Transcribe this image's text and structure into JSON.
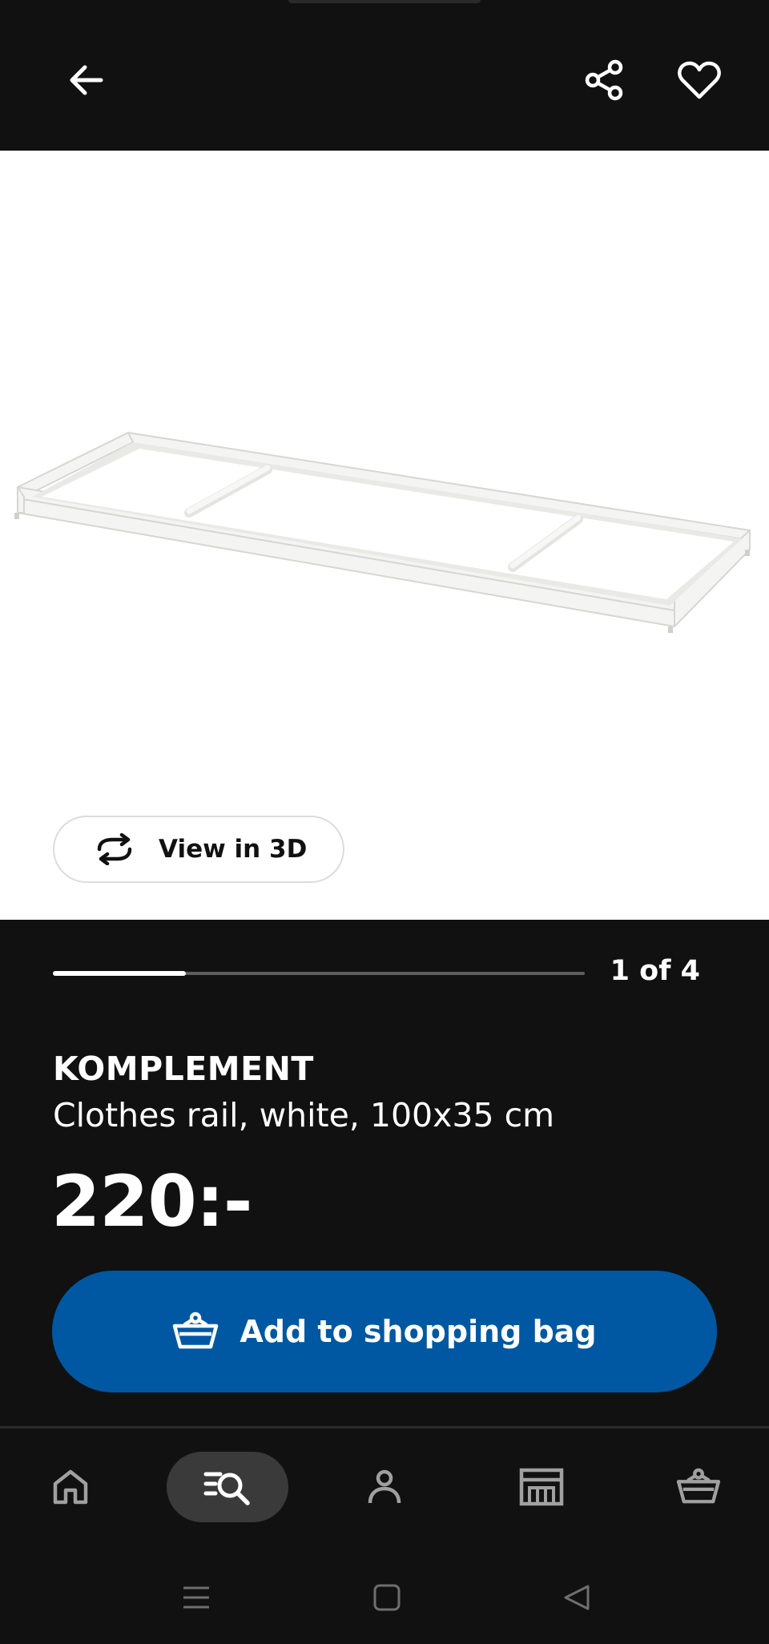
{
  "header": {
    "back_icon": "arrow-left-icon",
    "share_icon": "share-icon",
    "favourite_icon": "heart-outline-icon"
  },
  "gallery": {
    "view_3d_label": "View in 3D",
    "view_3d_icon": "rotate-3d-icon",
    "current_slide": 1,
    "total_slides": 4,
    "counter_text": "1 of 4",
    "progress_fraction": 0.25
  },
  "product": {
    "name": "KOMPLEMENT",
    "description": "Clothes rail, white, 100x35 cm",
    "price": "220:-"
  },
  "cta": {
    "add_to_bag_label": "Add to shopping bag",
    "icon": "shopping-basket-icon",
    "color": "#0058a3"
  },
  "bottom_nav": {
    "items": [
      {
        "icon": "home-icon",
        "active": false
      },
      {
        "icon": "search-list-icon",
        "active": true
      },
      {
        "icon": "profile-icon",
        "active": false
      },
      {
        "icon": "store-icon",
        "active": false
      },
      {
        "icon": "shopping-basket-icon",
        "active": false
      }
    ]
  },
  "system_nav": {
    "items": [
      "menu-icon",
      "home-square-icon",
      "back-triangle-icon"
    ]
  },
  "colors": {
    "background": "#111111",
    "image_background": "#ffffff",
    "accent": "#0058a3"
  }
}
